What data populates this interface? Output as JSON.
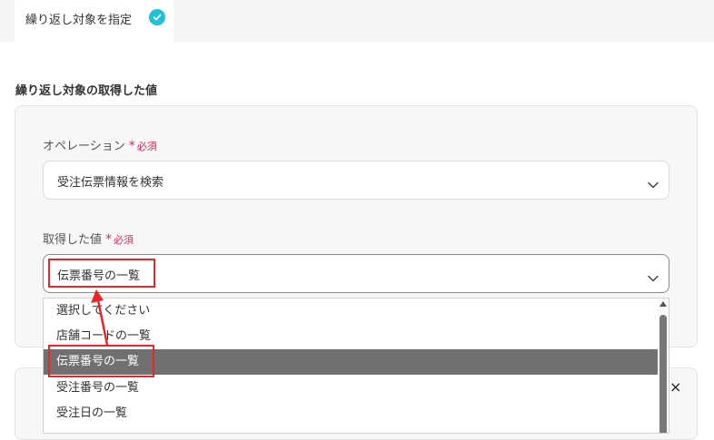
{
  "tab": {
    "label": "繰り返し対象を指定"
  },
  "section": {
    "title": "繰り返し対象の取得した値"
  },
  "operation": {
    "label": "オペレーション",
    "required_mark": "*",
    "required_text": "必須",
    "value": "受注伝票情報を検索"
  },
  "fetched": {
    "label": "取得した値",
    "required_mark": "*",
    "required_text": "必須",
    "value": "伝票番号の一覧"
  },
  "dropdown": {
    "options": [
      {
        "label": "選択してください"
      },
      {
        "label": "店舗コードの一覧"
      },
      {
        "label": "伝票番号の一覧"
      },
      {
        "label": "受注番号の一覧"
      },
      {
        "label": "受注日の一覧"
      }
    ],
    "highlighted_index": 2
  },
  "close": {
    "glyph": "×"
  },
  "colors": {
    "accent": "#20c1d6",
    "required": "#e0245e",
    "annotation": "#e8262a",
    "highlight": "#707070"
  },
  "icons": [
    "check-circle-icon",
    "chevron-down-icon",
    "close-icon",
    "scroll-up-icon"
  ]
}
